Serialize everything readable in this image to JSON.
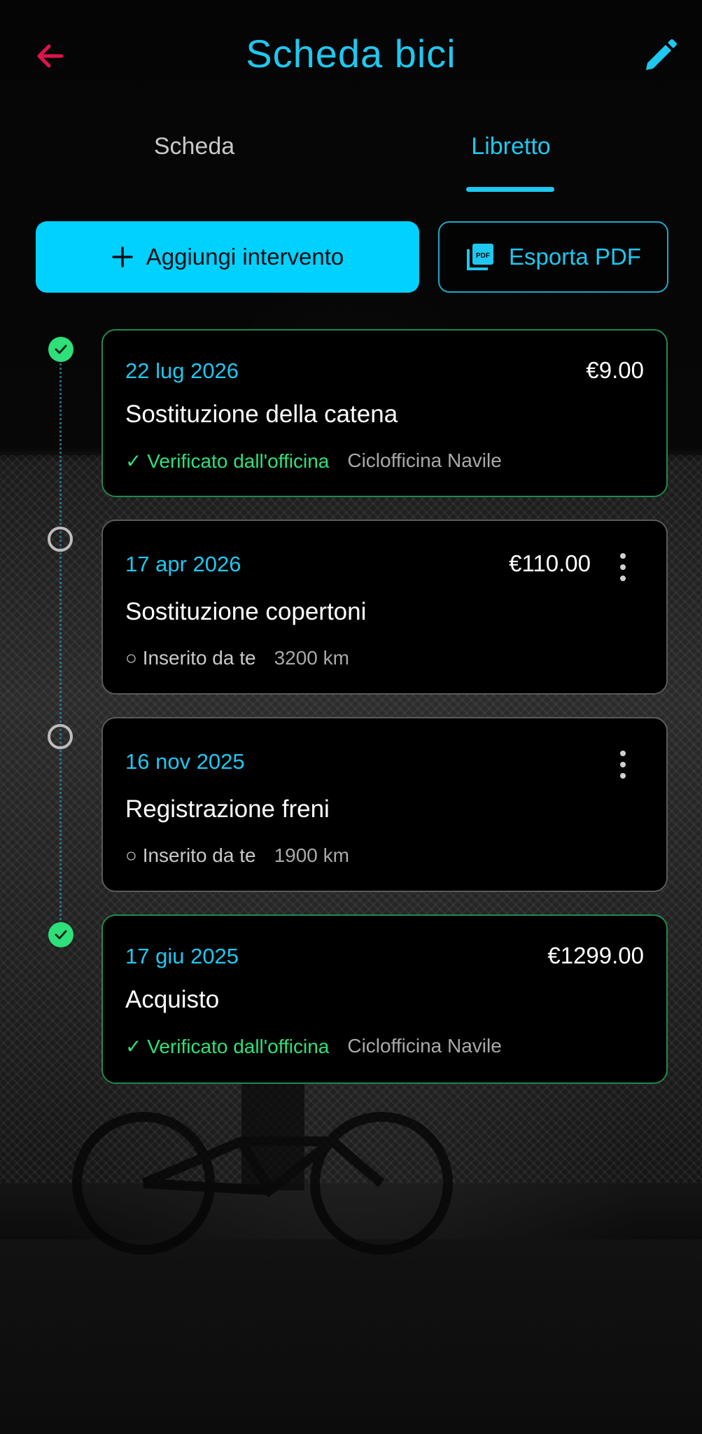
{
  "header": {
    "title": "Scheda bici",
    "back_icon": "arrow-left-icon",
    "edit_icon": "pencil-icon"
  },
  "tabs": [
    {
      "label": "Scheda",
      "active": false
    },
    {
      "label": "Libretto",
      "active": true
    }
  ],
  "actions": {
    "add_label": "Aggiungi intervento",
    "add_icon": "plus-icon",
    "pdf_label": "Esporta PDF",
    "pdf_icon": "pdf-file-icon"
  },
  "colors": {
    "accent": "#1EC8F0",
    "primary_button": "#00D1FF",
    "back_arrow": "#E0144C",
    "verified": "#2EE07A"
  },
  "entries": [
    {
      "date": "22 lug 2026",
      "amount": "€9.00",
      "title": "Sostituzione della catena",
      "status": "✓ Verificato dall'officina",
      "detail": "Ciclofficina Navile",
      "verified": true
    },
    {
      "date": "17 apr 2026",
      "amount": "€110.00",
      "title": "Sostituzione copertoni",
      "status": "○ Inserito da te",
      "detail": "3200 km",
      "verified": false
    },
    {
      "date": "16 nov 2025",
      "amount": "",
      "title": "Registrazione freni",
      "status": "○ Inserito da te",
      "detail": "1900 km",
      "verified": false
    },
    {
      "date": "17 giu 2025",
      "amount": "€1299.00",
      "title": "Acquisto",
      "status": "✓ Verificato dall'officina",
      "detail": "Ciclofficina Navile",
      "verified": true
    }
  ]
}
